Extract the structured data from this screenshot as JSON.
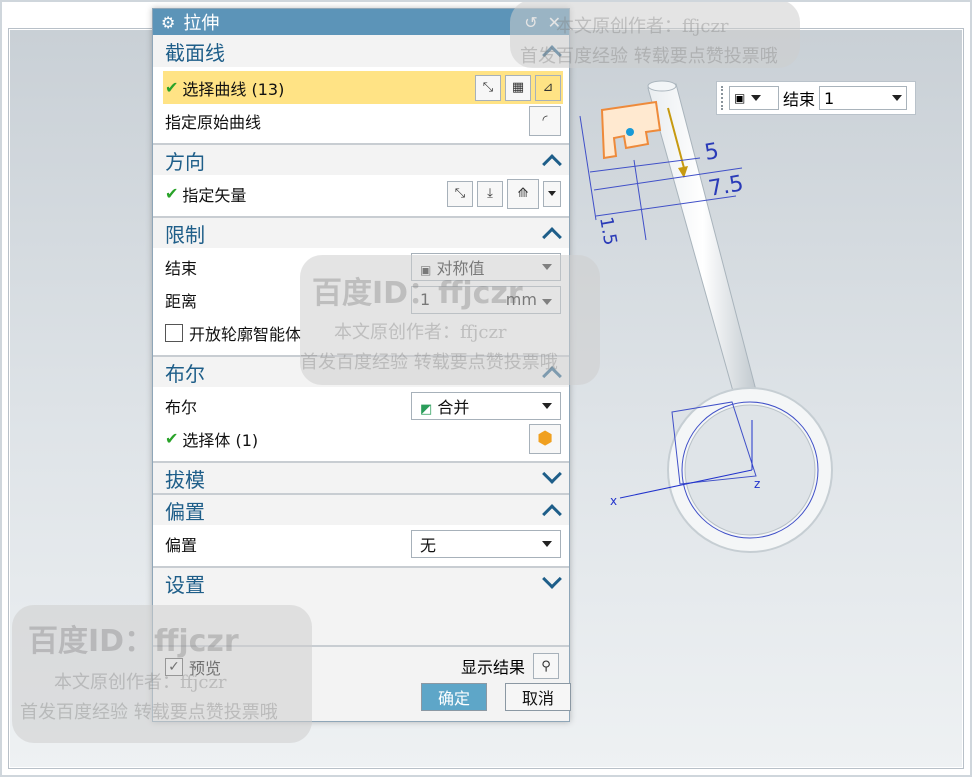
{
  "dialog": {
    "title": "拉伸",
    "sections": {
      "section": {
        "title": "截面线",
        "select_curve_label": "选择曲线 (13)",
        "specify_origin_label": "指定原始曲线"
      },
      "direction": {
        "title": "方向",
        "specify_vector_label": "指定矢量"
      },
      "limits": {
        "title": "限制",
        "end_label": "结束",
        "end_value": "对称值",
        "distance_label": "距离",
        "distance_value": "1",
        "distance_unit": "mm",
        "open_profile_label": "开放轮廓智能体"
      },
      "boolean": {
        "title": "布尔",
        "boolean_label": "布尔",
        "boolean_value": "合并",
        "select_body_label": "选择体 (1)"
      },
      "draft": {
        "title": "拔模"
      },
      "offset": {
        "title": "偏置",
        "offset_label": "偏置",
        "offset_value": "无"
      },
      "settings": {
        "title": "设置"
      }
    },
    "preview_label": "预览",
    "show_result_label": "显示结果",
    "ok_label": "确定",
    "cancel_label": "取消"
  },
  "end_toolbar": {
    "label": "结束",
    "value": "1"
  },
  "viewport": {
    "dimensions": [
      "5",
      "7.5",
      "1.5"
    ],
    "axes": [
      "x",
      "z"
    ]
  },
  "watermark": {
    "brand": "百度ID：ffjczr",
    "author": "本文原创作者：ffjczr",
    "notice": "首发百度经验  转载要点赞投票哦"
  },
  "colors": {
    "titlebar": "#5c94b8",
    "section_title": "#1e5e89",
    "highlight": "#ffe385",
    "ok_button": "#5ea6c8",
    "check": "#29a329"
  }
}
